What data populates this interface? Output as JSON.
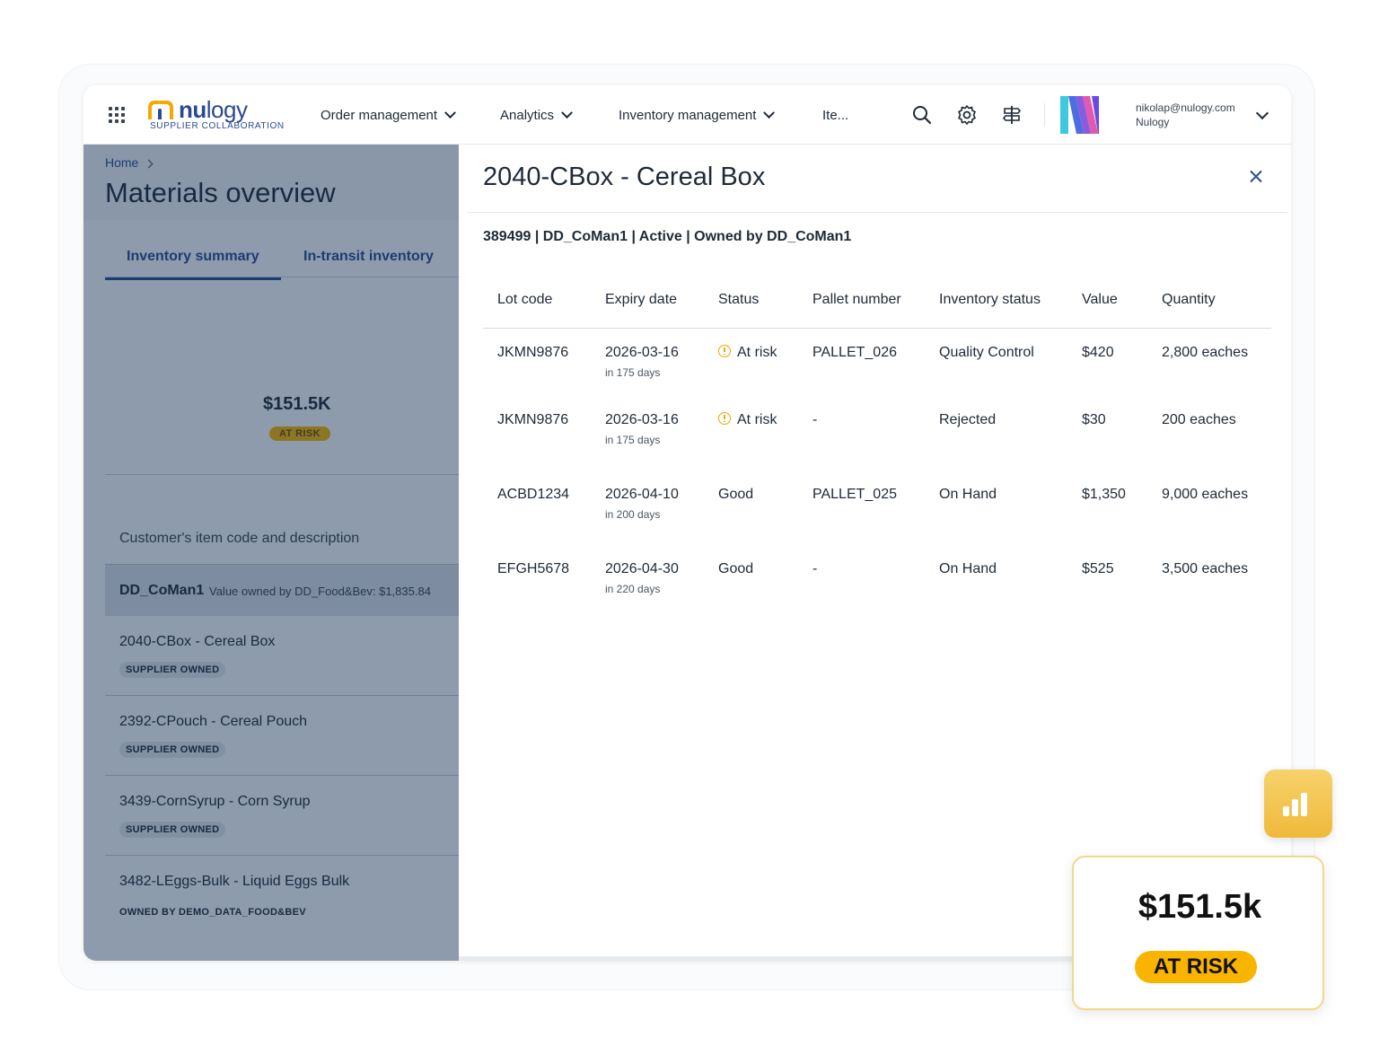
{
  "brand": {
    "logo_text_bold": "nu",
    "logo_text_light": "logy",
    "logo_subtitle": "SUPPLIER COLLABORATION"
  },
  "nav": {
    "menus": [
      "Order management",
      "Analytics",
      "Inventory management",
      "Ite..."
    ],
    "icons": [
      "apps-grid-icon",
      "search-icon",
      "gear-icon",
      "signpost-icon"
    ],
    "user_email": "nikolap@nulogy.com",
    "user_org": "Nulogy"
  },
  "left": {
    "breadcrumb": "Home",
    "page_title": "Materials overview",
    "tabs": [
      "Inventory summary",
      "In-transit inventory"
    ],
    "summary_value": "$151.5K",
    "summary_badge": "AT RISK",
    "list_header": "Customer's item code and description",
    "group_name": "DD_CoMan1",
    "group_detail": "Value owned by DD_Food&Bev: $1,835.84",
    "items": [
      {
        "name": "2040-CBox - Cereal Box",
        "badge": "SUPPLIER OWNED"
      },
      {
        "name": "2392-CPouch - Cereal Pouch",
        "badge": "SUPPLIER OWNED"
      },
      {
        "name": "3439-CornSyrup - Corn Syrup",
        "badge": "SUPPLIER OWNED"
      },
      {
        "name": "3482-LEggs-Bulk - Liquid Eggs Bulk",
        "badge": "OWNED BY DEMO_DATA_FOOD&BEV"
      }
    ]
  },
  "drawer": {
    "title": "2040-CBox - Cereal Box",
    "meta": "389499 | DD_CoMan1 | Active | Owned by DD_CoMan1",
    "columns": [
      "Lot code",
      "Expiry date",
      "Status",
      "Pallet number",
      "Inventory status",
      "Value",
      "Quantity"
    ],
    "rows": [
      {
        "lot": "JKMN9876",
        "expiry": "2026-03-16",
        "expiry_sub": "in 175 days",
        "status": "At risk",
        "warn": true,
        "pallet": "PALLET_026",
        "inv_status": "Quality Control",
        "value": "$420",
        "qty": "2,800 eaches"
      },
      {
        "lot": "JKMN9876",
        "expiry": "2026-03-16",
        "expiry_sub": "in 175 days",
        "status": "At risk",
        "warn": true,
        "pallet": "-",
        "inv_status": "Rejected",
        "value": "$30",
        "qty": "200 eaches"
      },
      {
        "lot": "ACBD1234",
        "expiry": "2026-04-10",
        "expiry_sub": "in 200 days",
        "status": "Good",
        "warn": false,
        "pallet": "PALLET_025",
        "inv_status": "On Hand",
        "value": "$1,350",
        "qty": "9,000 eaches"
      },
      {
        "lot": "EFGH5678",
        "expiry": "2026-04-30",
        "expiry_sub": "in 220 days",
        "status": "Good",
        "warn": false,
        "pallet": "-",
        "inv_status": "On Hand",
        "value": "$525",
        "qty": "3,500 eaches"
      }
    ]
  },
  "widget": {
    "value": "$151.5k",
    "badge": "AT RISK"
  },
  "colors": {
    "brand_blue": "#2a4b8e",
    "at_risk_yellow": "#f9b400",
    "overlay": "#102a4d"
  }
}
